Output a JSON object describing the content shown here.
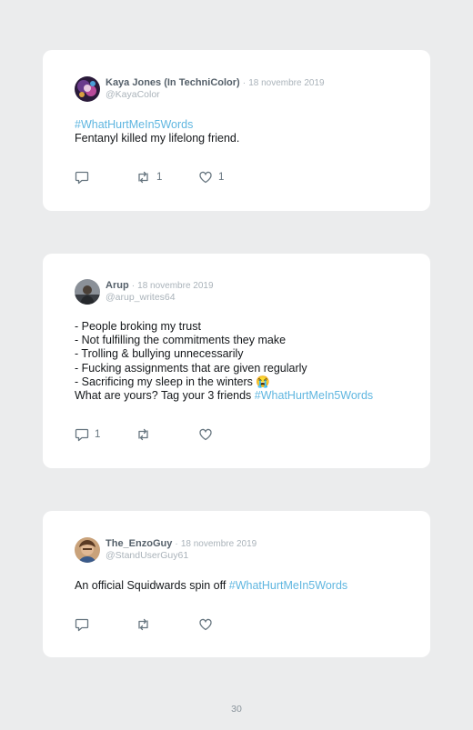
{
  "tweets": [
    {
      "name": "Kaya Jones (In TechniColor)",
      "separator": "·",
      "date": "18 novembre 2019",
      "handle": "@KayaColor",
      "lines": [
        {
          "text": "",
          "tag": "#WhatHurtMeIn5Words"
        },
        {
          "text": "Fentanyl killed my lifelong friend.",
          "tag": ""
        }
      ],
      "reply_count": "",
      "retweet_count": "1",
      "like_count": "1"
    },
    {
      "name": "Arup",
      "separator": "·",
      "date": "18 novembre 2019",
      "handle": "@arup_writes64",
      "lines": [
        {
          "text": "- People broking my trust",
          "tag": ""
        },
        {
          "text": "- Not fulfilling the commitments they make",
          "tag": ""
        },
        {
          "text": "- Trolling & bullying unnecessarily",
          "tag": ""
        },
        {
          "text": "- Fucking assignments that are given regularly",
          "tag": ""
        },
        {
          "text": "- Sacrificing my sleep in the winters 😭",
          "tag": ""
        },
        {
          "text": "What are yours? Tag your 3 friends ",
          "tag": "#WhatHurtMeIn5Words"
        }
      ],
      "reply_count": "1",
      "retweet_count": "",
      "like_count": ""
    },
    {
      "name": "The_EnzoGuy",
      "separator": "·",
      "date": "18 novembre 2019",
      "handle": "@StandUserGuy61",
      "lines": [
        {
          "text": "An official Squidwards spin off ",
          "tag": "#WhatHurtMeIn5Words"
        }
      ],
      "reply_count": "",
      "retweet_count": "",
      "like_count": ""
    }
  ],
  "icons": {
    "reply": "reply-icon",
    "retweet": "retweet-icon",
    "like": "heart-icon"
  },
  "colors": {
    "page_background": "#ebeced",
    "card_background": "#ffffff",
    "hashtag": "#5fb6e0",
    "muted": "#aab3ba"
  },
  "footer": {
    "page_number": "30"
  }
}
